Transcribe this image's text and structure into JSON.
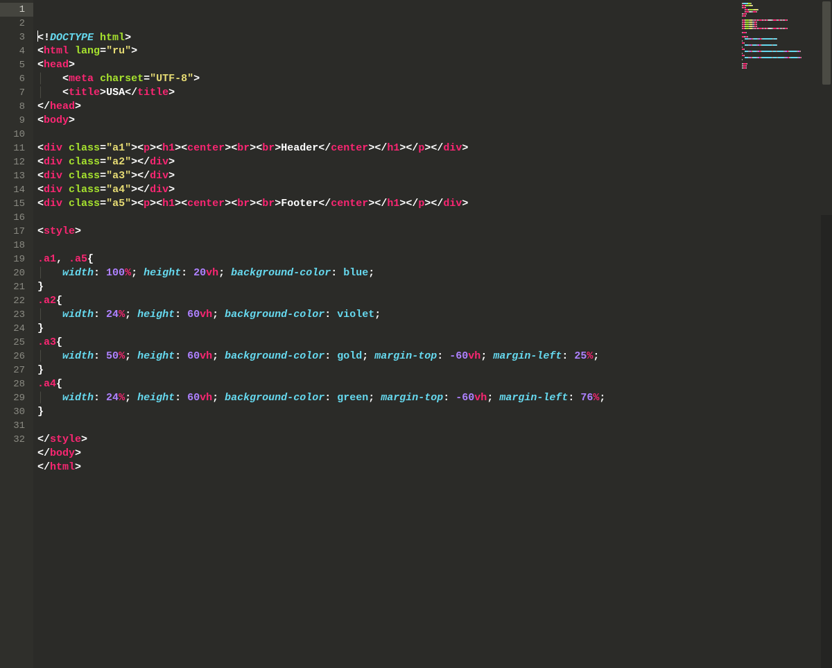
{
  "editor": {
    "line_count": 32,
    "current_line": 1,
    "lines": [
      {
        "n": 1,
        "indent": 0,
        "tokens": [
          {
            "t": "cursor"
          },
          {
            "t": "pun",
            "v": "<!"
          },
          {
            "t": "kw",
            "v": "DOCTYPE"
          },
          {
            "t": "text",
            "v": " "
          },
          {
            "t": "attr",
            "v": "html"
          },
          {
            "t": "pun",
            "v": ">"
          }
        ]
      },
      {
        "n": 2,
        "indent": 0,
        "tokens": [
          {
            "t": "pun",
            "v": "<"
          },
          {
            "t": "tag",
            "v": "html"
          },
          {
            "t": "text",
            "v": " "
          },
          {
            "t": "attr",
            "v": "lang"
          },
          {
            "t": "pun",
            "v": "="
          },
          {
            "t": "str",
            "v": "\"ru\""
          },
          {
            "t": "pun",
            "v": ">"
          }
        ]
      },
      {
        "n": 3,
        "indent": 0,
        "tokens": [
          {
            "t": "pun",
            "v": "<"
          },
          {
            "t": "tag",
            "v": "head"
          },
          {
            "t": "pun",
            "v": ">"
          }
        ]
      },
      {
        "n": 4,
        "indent": 1,
        "tokens": [
          {
            "t": "pun",
            "v": "<"
          },
          {
            "t": "tag",
            "v": "meta"
          },
          {
            "t": "text",
            "v": " "
          },
          {
            "t": "attr",
            "v": "charset"
          },
          {
            "t": "pun",
            "v": "="
          },
          {
            "t": "str",
            "v": "\"UTF-8\""
          },
          {
            "t": "pun",
            "v": ">"
          }
        ]
      },
      {
        "n": 5,
        "indent": 1,
        "tokens": [
          {
            "t": "pun",
            "v": "<"
          },
          {
            "t": "tag",
            "v": "title"
          },
          {
            "t": "pun",
            "v": ">"
          },
          {
            "t": "text",
            "v": "USA"
          },
          {
            "t": "pun",
            "v": "</"
          },
          {
            "t": "tag",
            "v": "title"
          },
          {
            "t": "pun",
            "v": ">"
          }
        ]
      },
      {
        "n": 6,
        "indent": 0,
        "tokens": [
          {
            "t": "pun",
            "v": "</"
          },
          {
            "t": "tag",
            "v": "head"
          },
          {
            "t": "pun",
            "v": ">"
          }
        ]
      },
      {
        "n": 7,
        "indent": 0,
        "tokens": [
          {
            "t": "pun",
            "v": "<"
          },
          {
            "t": "tag",
            "v": "body"
          },
          {
            "t": "pun",
            "v": ">"
          }
        ]
      },
      {
        "n": 8,
        "indent": 0,
        "tokens": []
      },
      {
        "n": 9,
        "indent": 0,
        "tokens": [
          {
            "t": "pun",
            "v": "<"
          },
          {
            "t": "tag",
            "v": "div"
          },
          {
            "t": "text",
            "v": " "
          },
          {
            "t": "attr",
            "v": "class"
          },
          {
            "t": "pun",
            "v": "="
          },
          {
            "t": "str",
            "v": "\"a1\""
          },
          {
            "t": "pun",
            "v": "><"
          },
          {
            "t": "tag",
            "v": "p"
          },
          {
            "t": "pun",
            "v": "><"
          },
          {
            "t": "tag",
            "v": "h1"
          },
          {
            "t": "pun",
            "v": "><"
          },
          {
            "t": "tag",
            "v": "center"
          },
          {
            "t": "pun",
            "v": "><"
          },
          {
            "t": "tag",
            "v": "br"
          },
          {
            "t": "pun",
            "v": "><"
          },
          {
            "t": "tag",
            "v": "br"
          },
          {
            "t": "pun",
            "v": ">"
          },
          {
            "t": "text",
            "v": "Header"
          },
          {
            "t": "pun",
            "v": "</"
          },
          {
            "t": "tag",
            "v": "center"
          },
          {
            "t": "pun",
            "v": "></"
          },
          {
            "t": "tag",
            "v": "h1"
          },
          {
            "t": "pun",
            "v": "></"
          },
          {
            "t": "tag",
            "v": "p"
          },
          {
            "t": "pun",
            "v": "></"
          },
          {
            "t": "tag",
            "v": "div"
          },
          {
            "t": "pun",
            "v": ">"
          }
        ]
      },
      {
        "n": 10,
        "indent": 0,
        "tokens": [
          {
            "t": "pun",
            "v": "<"
          },
          {
            "t": "tag",
            "v": "div"
          },
          {
            "t": "text",
            "v": " "
          },
          {
            "t": "attr",
            "v": "class"
          },
          {
            "t": "pun",
            "v": "="
          },
          {
            "t": "str",
            "v": "\"a2\""
          },
          {
            "t": "pun",
            "v": "></"
          },
          {
            "t": "tag",
            "v": "div"
          },
          {
            "t": "pun",
            "v": ">"
          }
        ]
      },
      {
        "n": 11,
        "indent": 0,
        "tokens": [
          {
            "t": "pun",
            "v": "<"
          },
          {
            "t": "tag",
            "v": "div"
          },
          {
            "t": "text",
            "v": " "
          },
          {
            "t": "attr",
            "v": "class"
          },
          {
            "t": "pun",
            "v": "="
          },
          {
            "t": "str",
            "v": "\"a3\""
          },
          {
            "t": "pun",
            "v": "></"
          },
          {
            "t": "tag",
            "v": "div"
          },
          {
            "t": "pun",
            "v": ">"
          }
        ]
      },
      {
        "n": 12,
        "indent": 0,
        "tokens": [
          {
            "t": "pun",
            "v": "<"
          },
          {
            "t": "tag",
            "v": "div"
          },
          {
            "t": "text",
            "v": " "
          },
          {
            "t": "attr",
            "v": "class"
          },
          {
            "t": "pun",
            "v": "="
          },
          {
            "t": "str",
            "v": "\"a4\""
          },
          {
            "t": "pun",
            "v": "></"
          },
          {
            "t": "tag",
            "v": "div"
          },
          {
            "t": "pun",
            "v": ">"
          }
        ]
      },
      {
        "n": 13,
        "indent": 0,
        "tokens": [
          {
            "t": "pun",
            "v": "<"
          },
          {
            "t": "tag",
            "v": "div"
          },
          {
            "t": "text",
            "v": " "
          },
          {
            "t": "attr",
            "v": "class"
          },
          {
            "t": "pun",
            "v": "="
          },
          {
            "t": "str",
            "v": "\"a5\""
          },
          {
            "t": "pun",
            "v": "><"
          },
          {
            "t": "tag",
            "v": "p"
          },
          {
            "t": "pun",
            "v": "><"
          },
          {
            "t": "tag",
            "v": "h1"
          },
          {
            "t": "pun",
            "v": "><"
          },
          {
            "t": "tag",
            "v": "center"
          },
          {
            "t": "pun",
            "v": "><"
          },
          {
            "t": "tag",
            "v": "br"
          },
          {
            "t": "pun",
            "v": "><"
          },
          {
            "t": "tag",
            "v": "br"
          },
          {
            "t": "pun",
            "v": ">"
          },
          {
            "t": "text",
            "v": "Footer"
          },
          {
            "t": "pun",
            "v": "</"
          },
          {
            "t": "tag",
            "v": "center"
          },
          {
            "t": "pun",
            "v": "></"
          },
          {
            "t": "tag",
            "v": "h1"
          },
          {
            "t": "pun",
            "v": "></"
          },
          {
            "t": "tag",
            "v": "p"
          },
          {
            "t": "pun",
            "v": "></"
          },
          {
            "t": "tag",
            "v": "div"
          },
          {
            "t": "pun",
            "v": ">"
          }
        ]
      },
      {
        "n": 14,
        "indent": 0,
        "tokens": []
      },
      {
        "n": 15,
        "indent": 0,
        "tokens": [
          {
            "t": "pun",
            "v": "<"
          },
          {
            "t": "tag",
            "v": "style"
          },
          {
            "t": "pun",
            "v": ">"
          }
        ]
      },
      {
        "n": 16,
        "indent": 0,
        "tokens": []
      },
      {
        "n": 17,
        "indent": 0,
        "tokens": [
          {
            "t": "tag",
            "v": ".a1"
          },
          {
            "t": "pun",
            "v": ", "
          },
          {
            "t": "tag",
            "v": ".a5"
          },
          {
            "t": "pun",
            "v": "{"
          }
        ]
      },
      {
        "n": 18,
        "indent": 1,
        "tokens": [
          {
            "t": "prop",
            "v": "width"
          },
          {
            "t": "pun",
            "v": ": "
          },
          {
            "t": "num",
            "v": "100"
          },
          {
            "t": "unit",
            "v": "%"
          },
          {
            "t": "pun",
            "v": "; "
          },
          {
            "t": "prop",
            "v": "height"
          },
          {
            "t": "pun",
            "v": ": "
          },
          {
            "t": "num",
            "v": "20"
          },
          {
            "t": "unit",
            "v": "vh"
          },
          {
            "t": "pun",
            "v": "; "
          },
          {
            "t": "prop",
            "v": "background-color"
          },
          {
            "t": "pun",
            "v": ": "
          },
          {
            "t": "val",
            "v": "blue"
          },
          {
            "t": "pun",
            "v": ";"
          }
        ]
      },
      {
        "n": 19,
        "indent": 0,
        "tokens": [
          {
            "t": "pun",
            "v": "}"
          }
        ]
      },
      {
        "n": 20,
        "indent": 0,
        "tokens": [
          {
            "t": "tag",
            "v": ".a2"
          },
          {
            "t": "pun",
            "v": "{"
          }
        ]
      },
      {
        "n": 21,
        "indent": 1,
        "tokens": [
          {
            "t": "prop",
            "v": "width"
          },
          {
            "t": "pun",
            "v": ": "
          },
          {
            "t": "num",
            "v": "24"
          },
          {
            "t": "unit",
            "v": "%"
          },
          {
            "t": "pun",
            "v": "; "
          },
          {
            "t": "prop",
            "v": "height"
          },
          {
            "t": "pun",
            "v": ": "
          },
          {
            "t": "num",
            "v": "60"
          },
          {
            "t": "unit",
            "v": "vh"
          },
          {
            "t": "pun",
            "v": "; "
          },
          {
            "t": "prop",
            "v": "background-color"
          },
          {
            "t": "pun",
            "v": ": "
          },
          {
            "t": "val",
            "v": "violet"
          },
          {
            "t": "pun",
            "v": ";"
          }
        ]
      },
      {
        "n": 22,
        "indent": 0,
        "tokens": [
          {
            "t": "pun",
            "v": "}"
          }
        ]
      },
      {
        "n": 23,
        "indent": 0,
        "tokens": [
          {
            "t": "tag",
            "v": ".a3"
          },
          {
            "t": "pun",
            "v": "{"
          }
        ]
      },
      {
        "n": 24,
        "indent": 1,
        "tokens": [
          {
            "t": "prop",
            "v": "width"
          },
          {
            "t": "pun",
            "v": ": "
          },
          {
            "t": "num",
            "v": "50"
          },
          {
            "t": "unit",
            "v": "%"
          },
          {
            "t": "pun",
            "v": "; "
          },
          {
            "t": "prop",
            "v": "height"
          },
          {
            "t": "pun",
            "v": ": "
          },
          {
            "t": "num",
            "v": "60"
          },
          {
            "t": "unit",
            "v": "vh"
          },
          {
            "t": "pun",
            "v": "; "
          },
          {
            "t": "prop",
            "v": "background-color"
          },
          {
            "t": "pun",
            "v": ": "
          },
          {
            "t": "val",
            "v": "gold"
          },
          {
            "t": "pun",
            "v": "; "
          },
          {
            "t": "prop",
            "v": "margin-top"
          },
          {
            "t": "pun",
            "v": ": "
          },
          {
            "t": "num",
            "v": "-60"
          },
          {
            "t": "unit",
            "v": "vh"
          },
          {
            "t": "pun",
            "v": "; "
          },
          {
            "t": "prop",
            "v": "margin-left"
          },
          {
            "t": "pun",
            "v": ": "
          },
          {
            "t": "num",
            "v": "25"
          },
          {
            "t": "unit",
            "v": "%"
          },
          {
            "t": "pun",
            "v": ";"
          }
        ]
      },
      {
        "n": 25,
        "indent": 0,
        "tokens": [
          {
            "t": "pun",
            "v": "}"
          }
        ]
      },
      {
        "n": 26,
        "indent": 0,
        "tokens": [
          {
            "t": "tag",
            "v": ".a4"
          },
          {
            "t": "pun",
            "v": "{"
          }
        ]
      },
      {
        "n": 27,
        "indent": 1,
        "tokens": [
          {
            "t": "prop",
            "v": "width"
          },
          {
            "t": "pun",
            "v": ": "
          },
          {
            "t": "num",
            "v": "24"
          },
          {
            "t": "unit",
            "v": "%"
          },
          {
            "t": "pun",
            "v": "; "
          },
          {
            "t": "prop",
            "v": "height"
          },
          {
            "t": "pun",
            "v": ": "
          },
          {
            "t": "num",
            "v": "60"
          },
          {
            "t": "unit",
            "v": "vh"
          },
          {
            "t": "pun",
            "v": "; "
          },
          {
            "t": "prop",
            "v": "background-color"
          },
          {
            "t": "pun",
            "v": ": "
          },
          {
            "t": "val",
            "v": "green"
          },
          {
            "t": "pun",
            "v": "; "
          },
          {
            "t": "prop",
            "v": "margin-top"
          },
          {
            "t": "pun",
            "v": ": "
          },
          {
            "t": "num",
            "v": "-60"
          },
          {
            "t": "unit",
            "v": "vh"
          },
          {
            "t": "pun",
            "v": "; "
          },
          {
            "t": "prop",
            "v": "margin-left"
          },
          {
            "t": "pun",
            "v": ": "
          },
          {
            "t": "num",
            "v": "76"
          },
          {
            "t": "unit",
            "v": "%"
          },
          {
            "t": "pun",
            "v": ";"
          }
        ]
      },
      {
        "n": 28,
        "indent": 0,
        "tokens": [
          {
            "t": "pun",
            "v": "}"
          }
        ]
      },
      {
        "n": 29,
        "indent": 0,
        "tokens": []
      },
      {
        "n": 30,
        "indent": 0,
        "tokens": [
          {
            "t": "pun",
            "v": "</"
          },
          {
            "t": "tag",
            "v": "style"
          },
          {
            "t": "pun",
            "v": ">"
          }
        ]
      },
      {
        "n": 31,
        "indent": 0,
        "tokens": [
          {
            "t": "pun",
            "v": "</"
          },
          {
            "t": "tag",
            "v": "body"
          },
          {
            "t": "pun",
            "v": ">"
          }
        ]
      },
      {
        "n": 32,
        "indent": 0,
        "tokens": [
          {
            "t": "pun",
            "v": "</"
          },
          {
            "t": "tag",
            "v": "html"
          },
          {
            "t": "pun",
            "v": ">"
          }
        ]
      }
    ]
  },
  "minimap_colors": {
    "pun": "#aaaaaa",
    "kw": "#66d9ef",
    "tag": "#f92672",
    "attr": "#a6e22e",
    "str": "#e6db74",
    "text": "#d0d0d0",
    "prop": "#66d9ef",
    "num": "#ae81ff",
    "unit": "#f92672",
    "val": "#66d9ef"
  }
}
